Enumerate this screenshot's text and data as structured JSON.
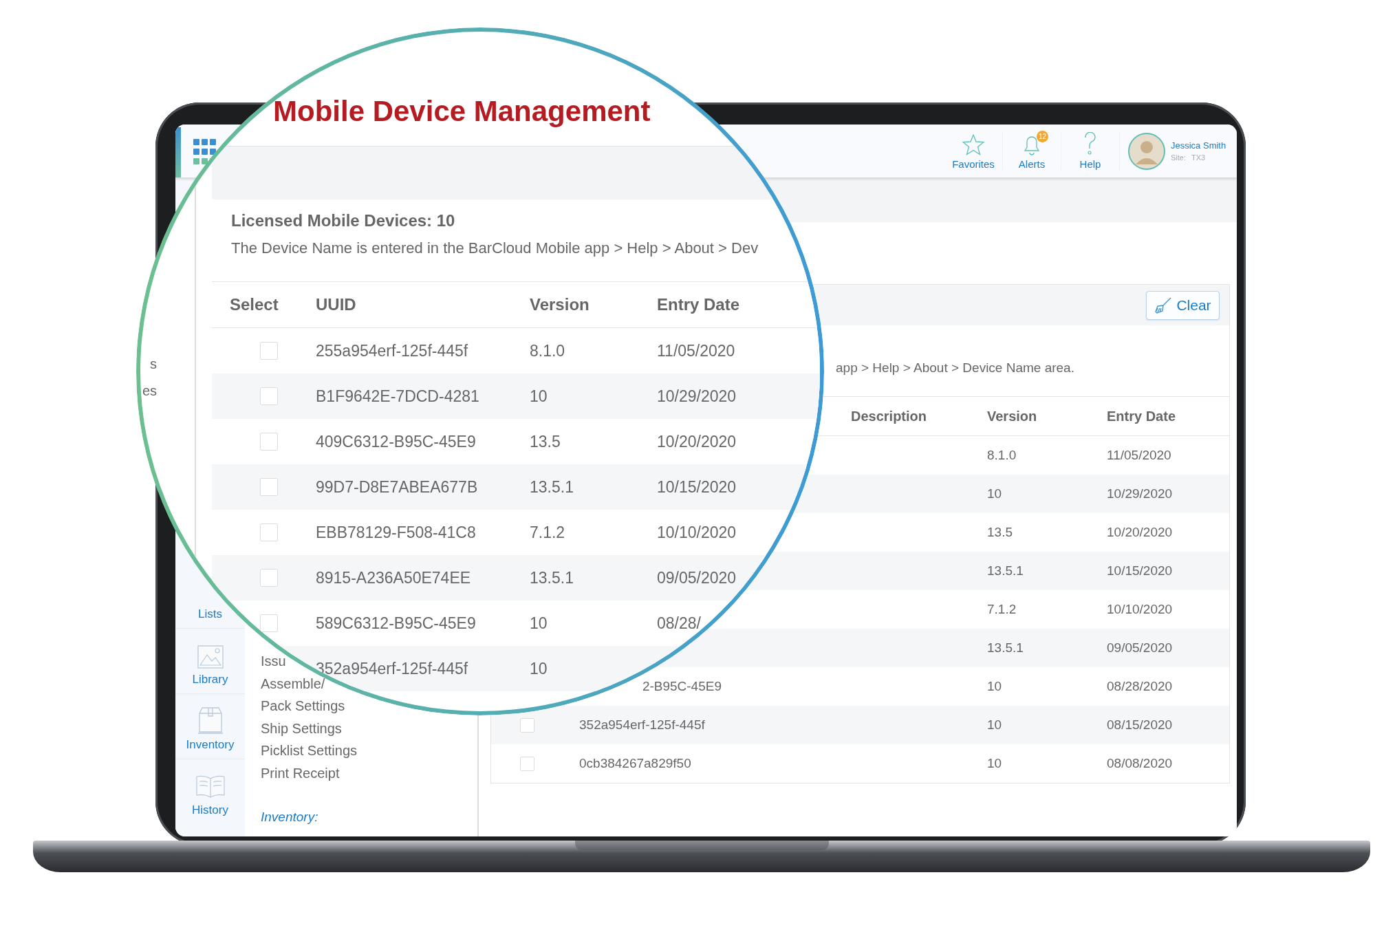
{
  "laptop_screen": {
    "header": {
      "items": [
        {
          "label": "Favorites",
          "kind": "star"
        },
        {
          "label": "Alerts",
          "kind": "bell",
          "badge": "12"
        },
        {
          "label": "Help",
          "kind": "help"
        }
      ],
      "user": {
        "name": "Jessica Smith",
        "site_label": "Site:",
        "site": "TX3"
      }
    },
    "sidebar": {
      "items": [
        {
          "label": "Lists",
          "kind": "hidden"
        },
        {
          "label": "Library",
          "kind": "picture"
        },
        {
          "label": "Inventory",
          "kind": "box"
        },
        {
          "label": "History",
          "kind": "book"
        }
      ]
    },
    "submenu": {
      "items": [
        "Issu",
        "Assemble/",
        "Pack Settings",
        "Ship Settings",
        "Picklist Settings",
        "Print Receipt"
      ],
      "section": "Inventory:"
    },
    "panel": {
      "clear_button": "Clear",
      "note": "app > Help > About > Device Name area.",
      "columns": [
        "Description",
        "Version",
        "Entry Date"
      ],
      "rows": [
        {
          "version": "8.1.0",
          "entry_date": "11/05/2020"
        },
        {
          "version": "10",
          "entry_date": "10/29/2020"
        },
        {
          "version": "13.5",
          "entry_date": "10/20/2020"
        },
        {
          "version": "13.5.1",
          "entry_date": "10/15/2020"
        },
        {
          "version": "7.1.2",
          "entry_date": "10/10/2020"
        },
        {
          "version": "13.5.1",
          "entry_date": "09/05/2020"
        },
        {
          "uuid": "2-B95C-45E9",
          "uuid_cut": true,
          "version": "10",
          "entry_date": "08/28/2020"
        },
        {
          "checked": false,
          "uuid": "352a954erf-125f-445f",
          "version": "10",
          "entry_date": "08/15/2020"
        },
        {
          "checked": false,
          "uuid": "0cb384267a829f50",
          "version": "10",
          "entry_date": "08/08/2020"
        }
      ]
    }
  },
  "magnifier": {
    "title": "Mobile Device Management",
    "side_texts": [
      "s",
      "es"
    ],
    "heading": "Licensed Mobile Devices: 10",
    "note": "The Device Name is entered in the BarCloud Mobile app > Help > About > Dev",
    "columns": [
      "Select",
      "UUID",
      "Version",
      "Entry Date"
    ],
    "rows": [
      {
        "checked": false,
        "uuid": "255a954erf-125f-445f",
        "version": "8.1.0",
        "entry_date": "11/05/2020"
      },
      {
        "checked": false,
        "uuid": "B1F9642E-7DCD-4281",
        "version": "10",
        "entry_date": "10/29/2020"
      },
      {
        "checked": false,
        "uuid": "409C6312-B95C-45E9",
        "version": "13.5",
        "entry_date": "10/20/2020"
      },
      {
        "checked": false,
        "uuid": "99D7-D8E7ABEA677B",
        "version": "13.5.1",
        "entry_date": "10/15/2020"
      },
      {
        "checked": false,
        "uuid": "EBB78129-F508-41C8",
        "version": "7.1.2",
        "entry_date": "10/10/2020"
      },
      {
        "checked": false,
        "uuid": "8915-A236A50E74EE",
        "version": "13.5.1",
        "entry_date": "09/05/2020"
      },
      {
        "checked": false,
        "uuid": "589C6312-B95C-45E9",
        "version": "10",
        "entry_date": "08/28/"
      },
      {
        "uuid": "352a954erf-125f-445f",
        "version": "10"
      }
    ]
  }
}
